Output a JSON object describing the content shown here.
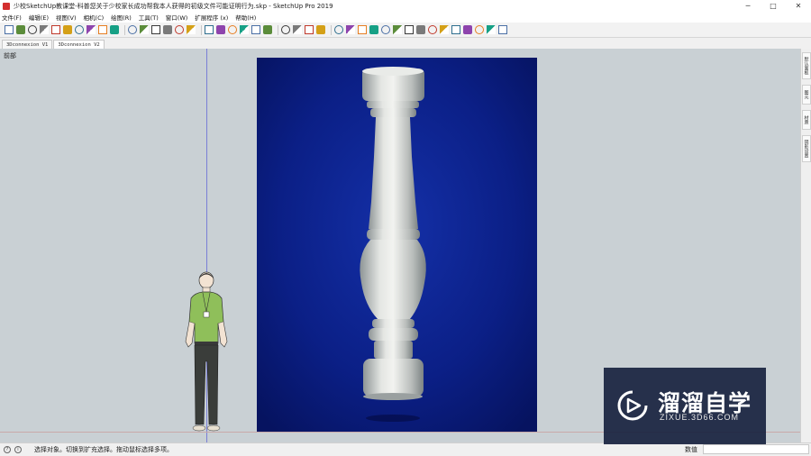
{
  "titlebar": {
    "title": "少校SketchUp教课堂-科普您关于少校家长成功帮我本人获得的初级文件可能证明行为.skp - SketchUp Pro 2019",
    "minimize": "─",
    "maximize": "□",
    "close": "✕"
  },
  "menubar": {
    "items": [
      "文件(F)",
      "编辑(E)",
      "视图(V)",
      "相机(C)",
      "绘图(R)",
      "工具(T)",
      "窗口(W)",
      "扩展程序 (x)",
      "帮助(H)"
    ]
  },
  "toolbar": {
    "icons": [
      "select-tool-icon",
      "eraser-icon",
      "line-icon",
      "arc-icon",
      "rectangle-icon",
      "push-pull-icon",
      "move-icon",
      "rotate-icon",
      "scale-icon",
      "offset-icon",
      "orbit-icon",
      "pan-icon",
      "zoom-icon",
      "zoom-extents-icon",
      "position-camera-icon",
      "section-plane-icon",
      "component-icon",
      "paint-bucket-icon",
      "warehouse-icon",
      "extension-icon",
      "camera-icon",
      "prev-view-icon",
      "next-view-icon",
      "standard-views-icon",
      "styles-icon",
      "x-ray-icon",
      "pencil-icon",
      "dimension-icon",
      "text-icon",
      "protractor-icon",
      "axes-icon",
      "3d-text-icon",
      "tape-measure-icon",
      "sandbox-icon",
      "flip-icon",
      "follow-me-icon",
      "intersect-icon",
      "outer-shell-icon",
      "solid-tools-icon",
      "material-icon",
      "shadow-icon"
    ]
  },
  "scenes": {
    "tabs": [
      "3Dconnexion V1",
      "3Dconnexion V2"
    ]
  },
  "viewport": {
    "label": "前部"
  },
  "rightpanel": {
    "tabs": [
      "默认面板",
      "图元",
      "材质",
      "阴影设置"
    ]
  },
  "status": {
    "help_icon": "?",
    "info_icon": "i",
    "text": "选择对象。切换到扩充选择。拖动鼠标选择多项。",
    "measure_label": "数值",
    "measure_value": ""
  },
  "watermark": {
    "title": "溜溜自学",
    "url": "ZIXUE.3D66.COM"
  },
  "colors": {
    "viewport_bg": "#c9d0d4",
    "photo_bg": "#0a1f8a",
    "baluster": "#d8dbd8",
    "watermark_bg": "#141e3c"
  }
}
